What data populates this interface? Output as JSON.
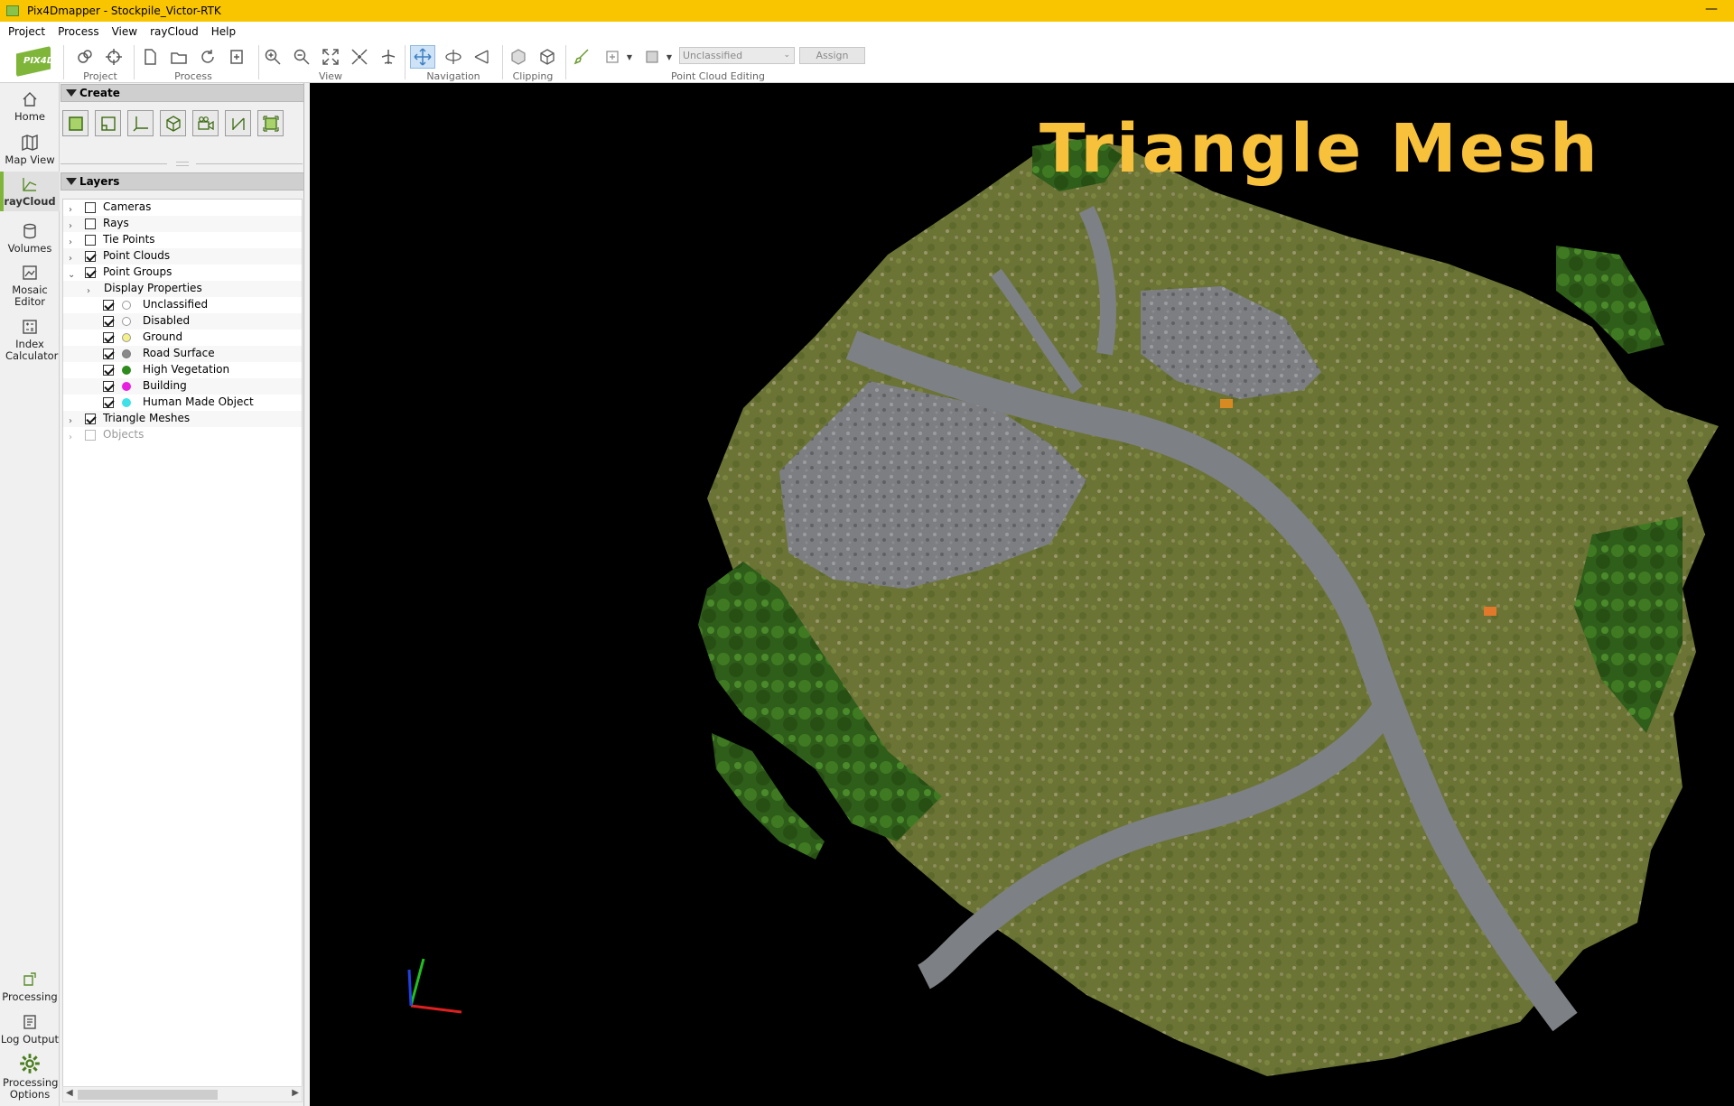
{
  "window": {
    "title": "Pix4Dmapper - Stockpile_Victor-RTK",
    "minimize": "—"
  },
  "menu": [
    "Project",
    "Process",
    "View",
    "rayCloud",
    "Help"
  ],
  "ribbon": {
    "logo": "PIX4D",
    "groups": [
      "Project",
      "Process",
      "View",
      "Navigation",
      "Clipping",
      "Point Cloud Editing"
    ],
    "class_select": {
      "value": "Unclassified"
    },
    "assign_label": "Assign"
  },
  "leftnav": {
    "top": [
      {
        "label": "Home",
        "icon": "home-icon"
      },
      {
        "label": "Map View",
        "icon": "map-icon"
      },
      {
        "label": "rayCloud",
        "icon": "raycloud-icon",
        "active": true
      },
      {
        "label": "Volumes",
        "icon": "cylinder-icon"
      },
      {
        "label": "Mosaic Editor",
        "icon": "mosaic-icon"
      },
      {
        "label": "Index Calculator",
        "icon": "calculator-icon"
      }
    ],
    "bottom": [
      {
        "label": "Processing",
        "icon": "processing-icon"
      },
      {
        "label": "Log Output",
        "icon": "log-icon"
      },
      {
        "label": "Processing Options",
        "icon": "gear-icon"
      }
    ]
  },
  "panel": {
    "create_header": "Create",
    "layers_header": "Layers",
    "layers": [
      {
        "label": "Cameras",
        "checked": false,
        "expanded": false,
        "level": 0
      },
      {
        "label": "Rays",
        "checked": false,
        "expanded": false,
        "level": 0
      },
      {
        "label": "Tie Points",
        "checked": false,
        "expanded": false,
        "level": 0
      },
      {
        "label": "Point Clouds",
        "checked": true,
        "expanded": false,
        "level": 0
      },
      {
        "label": "Point Groups",
        "checked": true,
        "expanded": true,
        "level": 0
      },
      {
        "label": "Display Properties",
        "level": 1
      },
      {
        "label": "Unclassified",
        "checked": true,
        "color": "#ffffff",
        "level": 2
      },
      {
        "label": "Disabled",
        "checked": true,
        "color": "#ffffff",
        "level": 2
      },
      {
        "label": "Ground",
        "checked": true,
        "color": "#f5f08a",
        "level": 2
      },
      {
        "label": "Road Surface",
        "checked": true,
        "color": "#8a8a8a",
        "level": 2
      },
      {
        "label": "High Vegetation",
        "checked": true,
        "color": "#2e8b1e",
        "level": 2
      },
      {
        "label": "Building",
        "checked": true,
        "color": "#e81ee0",
        "level": 2
      },
      {
        "label": "Human Made Object",
        "checked": true,
        "color": "#3fe0e8",
        "level": 2
      },
      {
        "label": "Triangle Meshes",
        "checked": true,
        "expanded": false,
        "level": 0
      },
      {
        "label": "Objects",
        "checked": false,
        "expanded": false,
        "level": 0,
        "disabled": true
      }
    ]
  },
  "viewport": {
    "overlay_title": "Triangle Mesh"
  }
}
